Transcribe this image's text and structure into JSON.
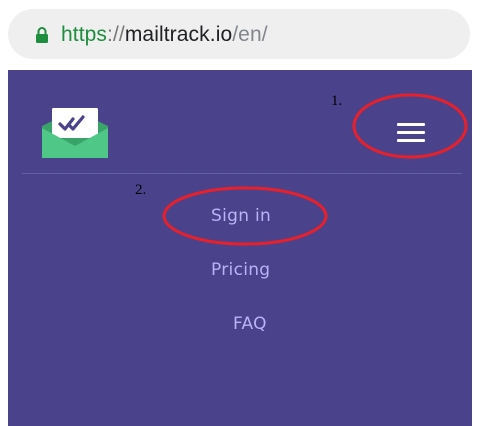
{
  "browser": {
    "url_scheme": "https",
    "url_separator": "://",
    "url_host": "mailtrack.io",
    "url_path": "/en/"
  },
  "header": {
    "logo_icon": "mailtrack-envelope-double-check-icon",
    "menu_icon": "hamburger-menu-icon"
  },
  "nav": {
    "items": [
      {
        "label": "Sign in"
      },
      {
        "label": "Pricing"
      },
      {
        "label": "FAQ"
      }
    ]
  },
  "annotations": {
    "step1": "1.",
    "step2": "2."
  },
  "colors": {
    "site_background": "#4b428c",
    "nav_link": "#b9b3f5",
    "annotation_circle": "#e8202a",
    "lock_green": "#1e8e3e",
    "logo_green": "#4fc786"
  }
}
